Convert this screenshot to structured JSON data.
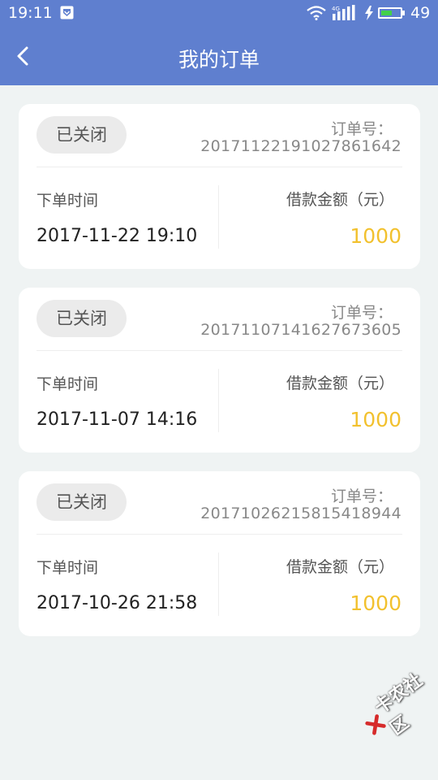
{
  "status_bar": {
    "time": "19:11",
    "battery_percent": "49",
    "network": "4G",
    "icons": [
      "notification-icon",
      "wifi-icon",
      "signal-icon",
      "charging-icon",
      "battery-icon"
    ]
  },
  "header": {
    "title": "我的订单",
    "back_icon": "chevron-left-icon"
  },
  "orders": [
    {
      "status": "已关闭",
      "order_no_label": "订单号：",
      "order_no": "20171122191027861642",
      "time_label": "下单时间",
      "time": "2017-11-22 19:10",
      "amount_label": "借款金额（元）",
      "amount": "1000"
    },
    {
      "status": "已关闭",
      "order_no_label": "订单号：",
      "order_no": "20171107141627673605",
      "time_label": "下单时间",
      "time": "2017-11-07 14:16",
      "amount_label": "借款金额（元）",
      "amount": "1000"
    },
    {
      "status": "已关闭",
      "order_no_label": "订单号：",
      "order_no": "20171026215815418944",
      "time_label": "下单时间",
      "time": "2017-10-26 21:58",
      "amount_label": "借款金额（元）",
      "amount": "1000"
    }
  ],
  "colors": {
    "primary": "#5f7fcf",
    "amount": "#f2c12e",
    "background": "#eff3f3",
    "badge_bg": "#ebebeb"
  },
  "watermark": "卡农社区"
}
